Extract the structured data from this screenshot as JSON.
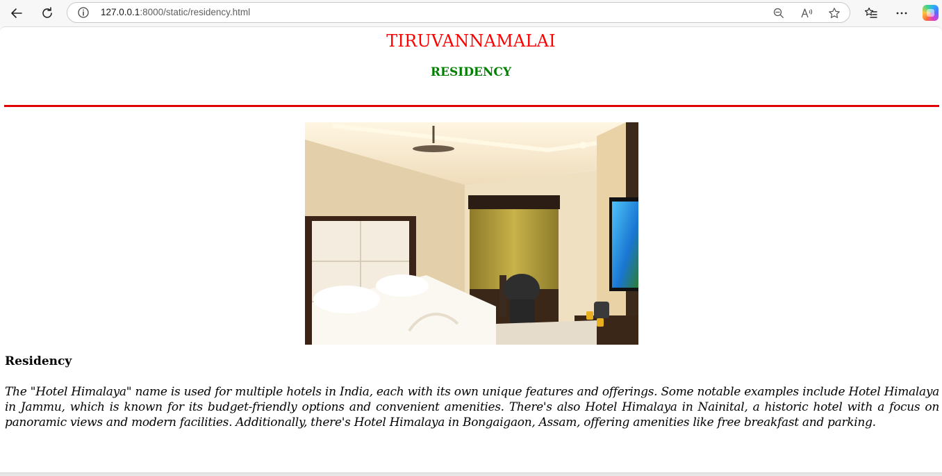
{
  "browser": {
    "url_host": "127.0.0.1",
    "url_path": ":8000/static/residency.html"
  },
  "page": {
    "title": "TIRUVANNAMALAI",
    "subtitle": "RESIDENCY",
    "section_heading": "Residency",
    "description": "The \"Hotel Himalaya\" name is used for multiple hotels in India, each with its own unique features and offerings. Some notable examples include Hotel Himalaya in Jammu, which is known for its budget-friendly options and convenient amenities. There's also Hotel Himalaya in Nainital, a historic hotel with a focus on panoramic views and modern facilities. Additionally, there's Hotel Himalaya in Bongaigaon, Assam, offering amenities like free breakfast and parking."
  },
  "colors": {
    "title": "#ff0000",
    "subtitle": "#008000",
    "rule": "#e00000"
  },
  "icons": [
    "back-icon",
    "refresh-icon",
    "info-icon",
    "zoom-out-icon",
    "read-aloud-icon",
    "favorite-star-icon",
    "favorites-icon",
    "more-icon",
    "copilot-icon"
  ]
}
